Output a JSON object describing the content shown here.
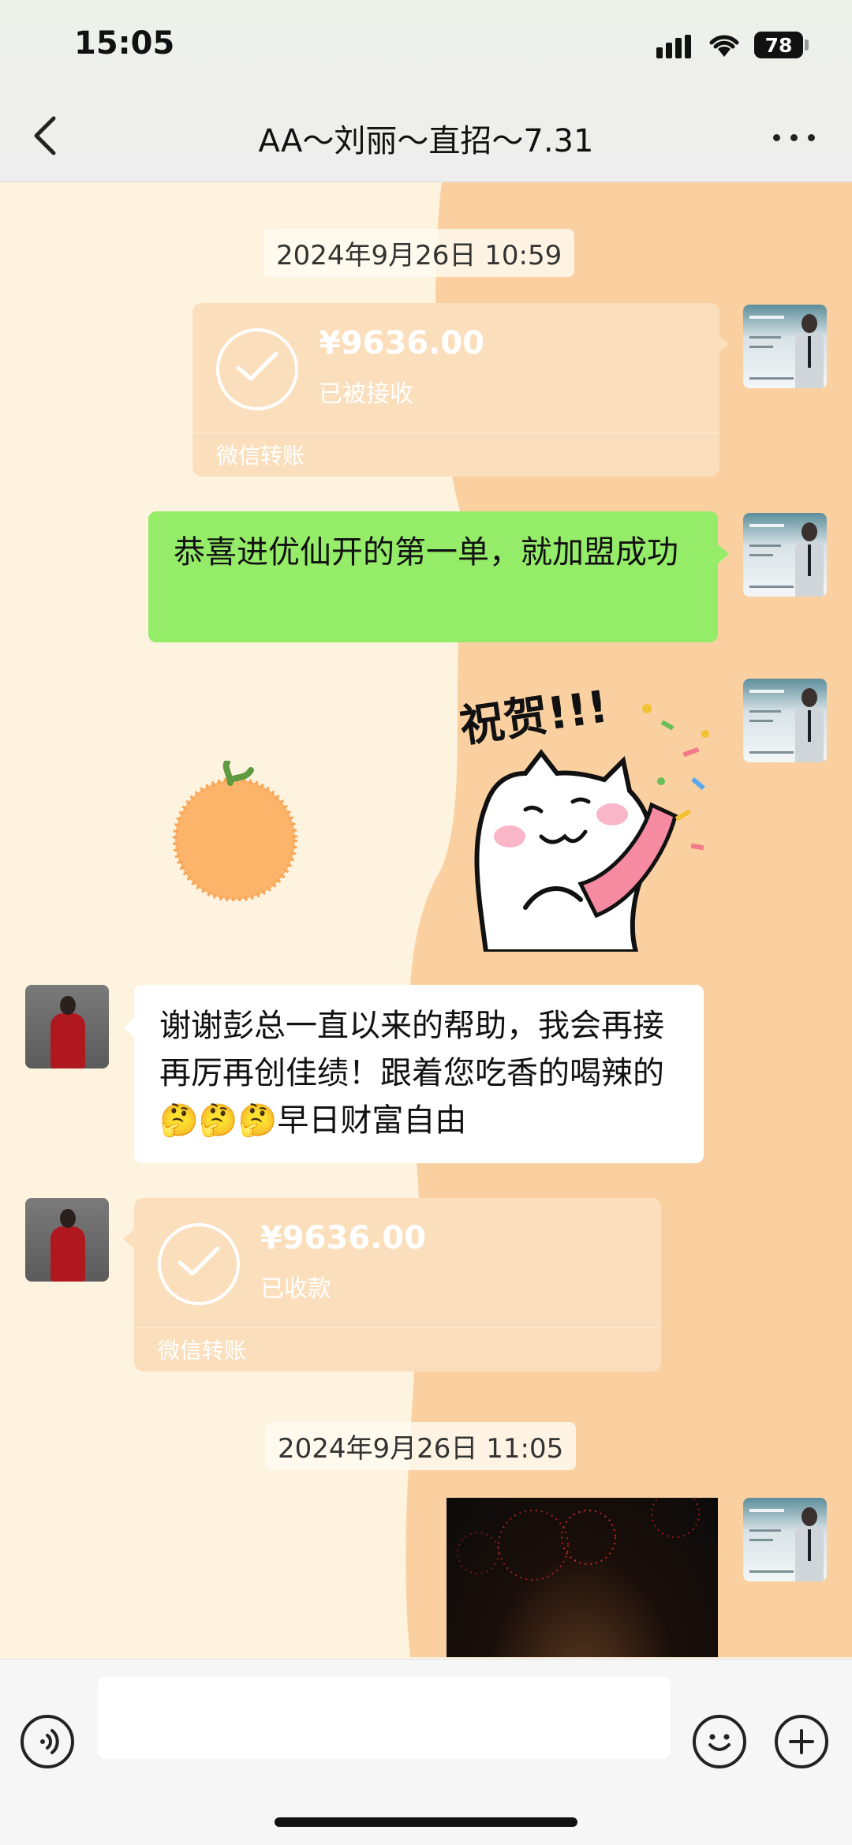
{
  "status_bar": {
    "time": "15:05",
    "battery": "78"
  },
  "nav": {
    "title": "AA～刘丽～直招～7.31"
  },
  "messages": {
    "timestamp_1": "2024年9月26日 10:59",
    "transfer_1": {
      "amount": "¥9636.00",
      "state": "已被接收",
      "brand": "微信转账"
    },
    "text_me": "恭喜进优仙开的第一单，就加盟成功",
    "sticker_text": "祝贺!!!",
    "text_her": "谢谢彭总一直以来的帮助，我会再接再厉再创佳绩！跟着您吃香的喝辣的🤔🤔🤔早日财富自由",
    "transfer_2": {
      "amount": "¥9636.00",
      "state": "已收款",
      "brand": "微信转账"
    },
    "timestamp_2": "2024年9月26日 11:05"
  },
  "colors": {
    "my_bubble": "#95ec69",
    "her_bubble": "#ffffff",
    "transfer_card": "#fbdfbd",
    "wallpaper_cream": "#fdf3df",
    "wallpaper_orange": "#fbd0a1"
  },
  "icons": {
    "back": "chevron-left-icon",
    "more": "more-dots-icon",
    "voice": "voice-icon",
    "emoji": "emoji-icon",
    "plus": "plus-icon"
  }
}
